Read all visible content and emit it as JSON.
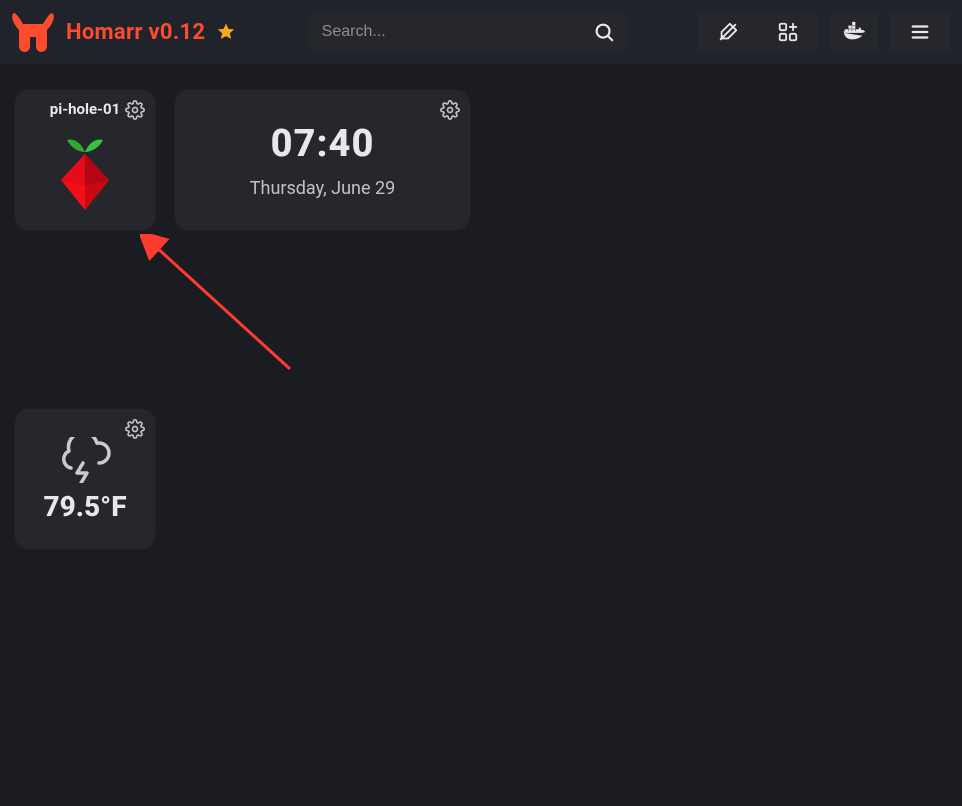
{
  "header": {
    "title": "Homarr v0.12",
    "search_placeholder": "Search..."
  },
  "cards": {
    "pihole": {
      "label": "pi-hole-01"
    },
    "clock": {
      "time": "07:40",
      "date": "Thursday, June 29"
    },
    "weather": {
      "temperature": "79.5°F",
      "condition": "thunderstorm"
    }
  },
  "colors": {
    "accent": "#fd4b2d",
    "star": "#f5a623",
    "card_bg": "#25272c",
    "bg": "#1a1c21"
  }
}
